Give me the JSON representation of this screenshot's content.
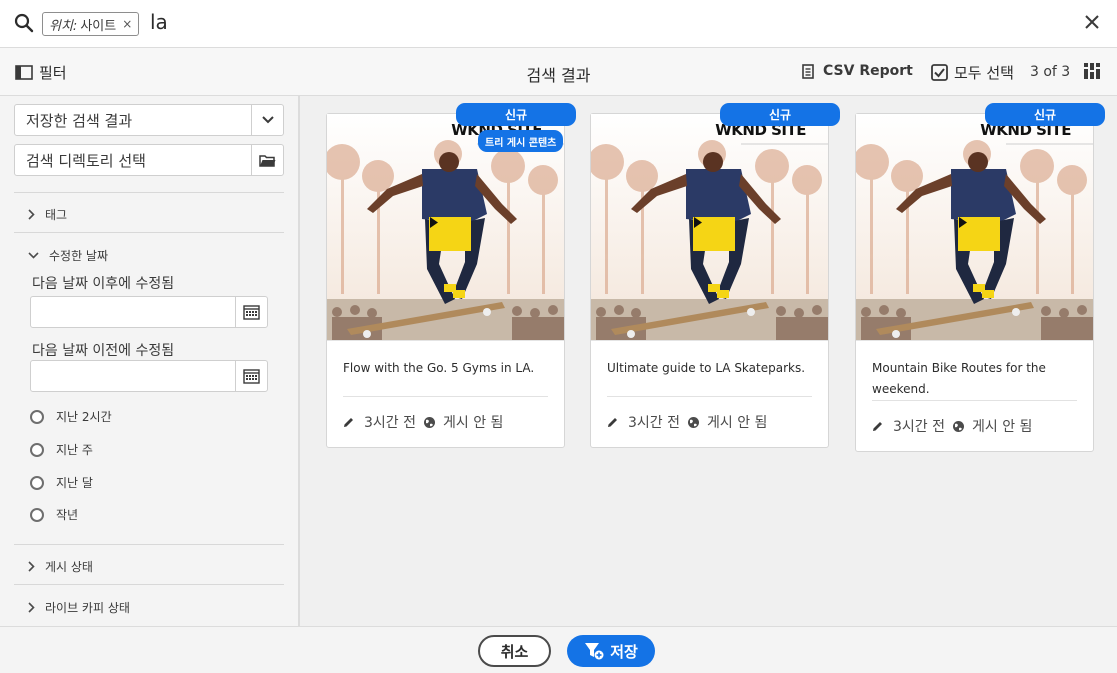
{
  "search": {
    "tag_label": "위치:",
    "tag_value": "사이트",
    "tag_remove": "×",
    "query": "la"
  },
  "header": {
    "filter_label": "필터",
    "title": "검색 결과",
    "csv_label": "CSV Report",
    "select_all_label": "모두 선택",
    "count": "3 of 3"
  },
  "sidebar": {
    "saved_search": "저장한 검색 결과",
    "directory": "검색 디렉토리 선택",
    "sections": {
      "tags": "태그",
      "modified": "수정한 날짜",
      "publish_status": "게시 상태",
      "livecopy_status": "라이브 카피 상태"
    },
    "after_label": "다음 날짜 이후에 수정됨",
    "before_label": "다음 날짜 이전에 수정됨",
    "radios": [
      "지난 2시간",
      "지난 주",
      "지난 달",
      "작년"
    ]
  },
  "cards": [
    {
      "title": "Flow with the Go. 5 Gyms in LA.",
      "badge": "신규",
      "sub_badge": "트리 게시 콘텐츠",
      "modified": "3시간 전",
      "status": "게시 안 됨",
      "site_text": "WKND SITE"
    },
    {
      "title": "Ultimate guide to LA Skateparks.",
      "badge": "신규",
      "modified": "3시간 전",
      "status": "게시 안 됨",
      "site_text": "WKND SITE"
    },
    {
      "title": "Mountain Bike Routes for the weekend.",
      "badge": "신규",
      "modified": "3시간 전",
      "status": "게시 안 됨",
      "site_text": "WKND SITE"
    }
  ],
  "footer": {
    "cancel": "취소",
    "save": "저장"
  },
  "colors": {
    "accent": "#1473e6",
    "play": "#f5d515"
  }
}
